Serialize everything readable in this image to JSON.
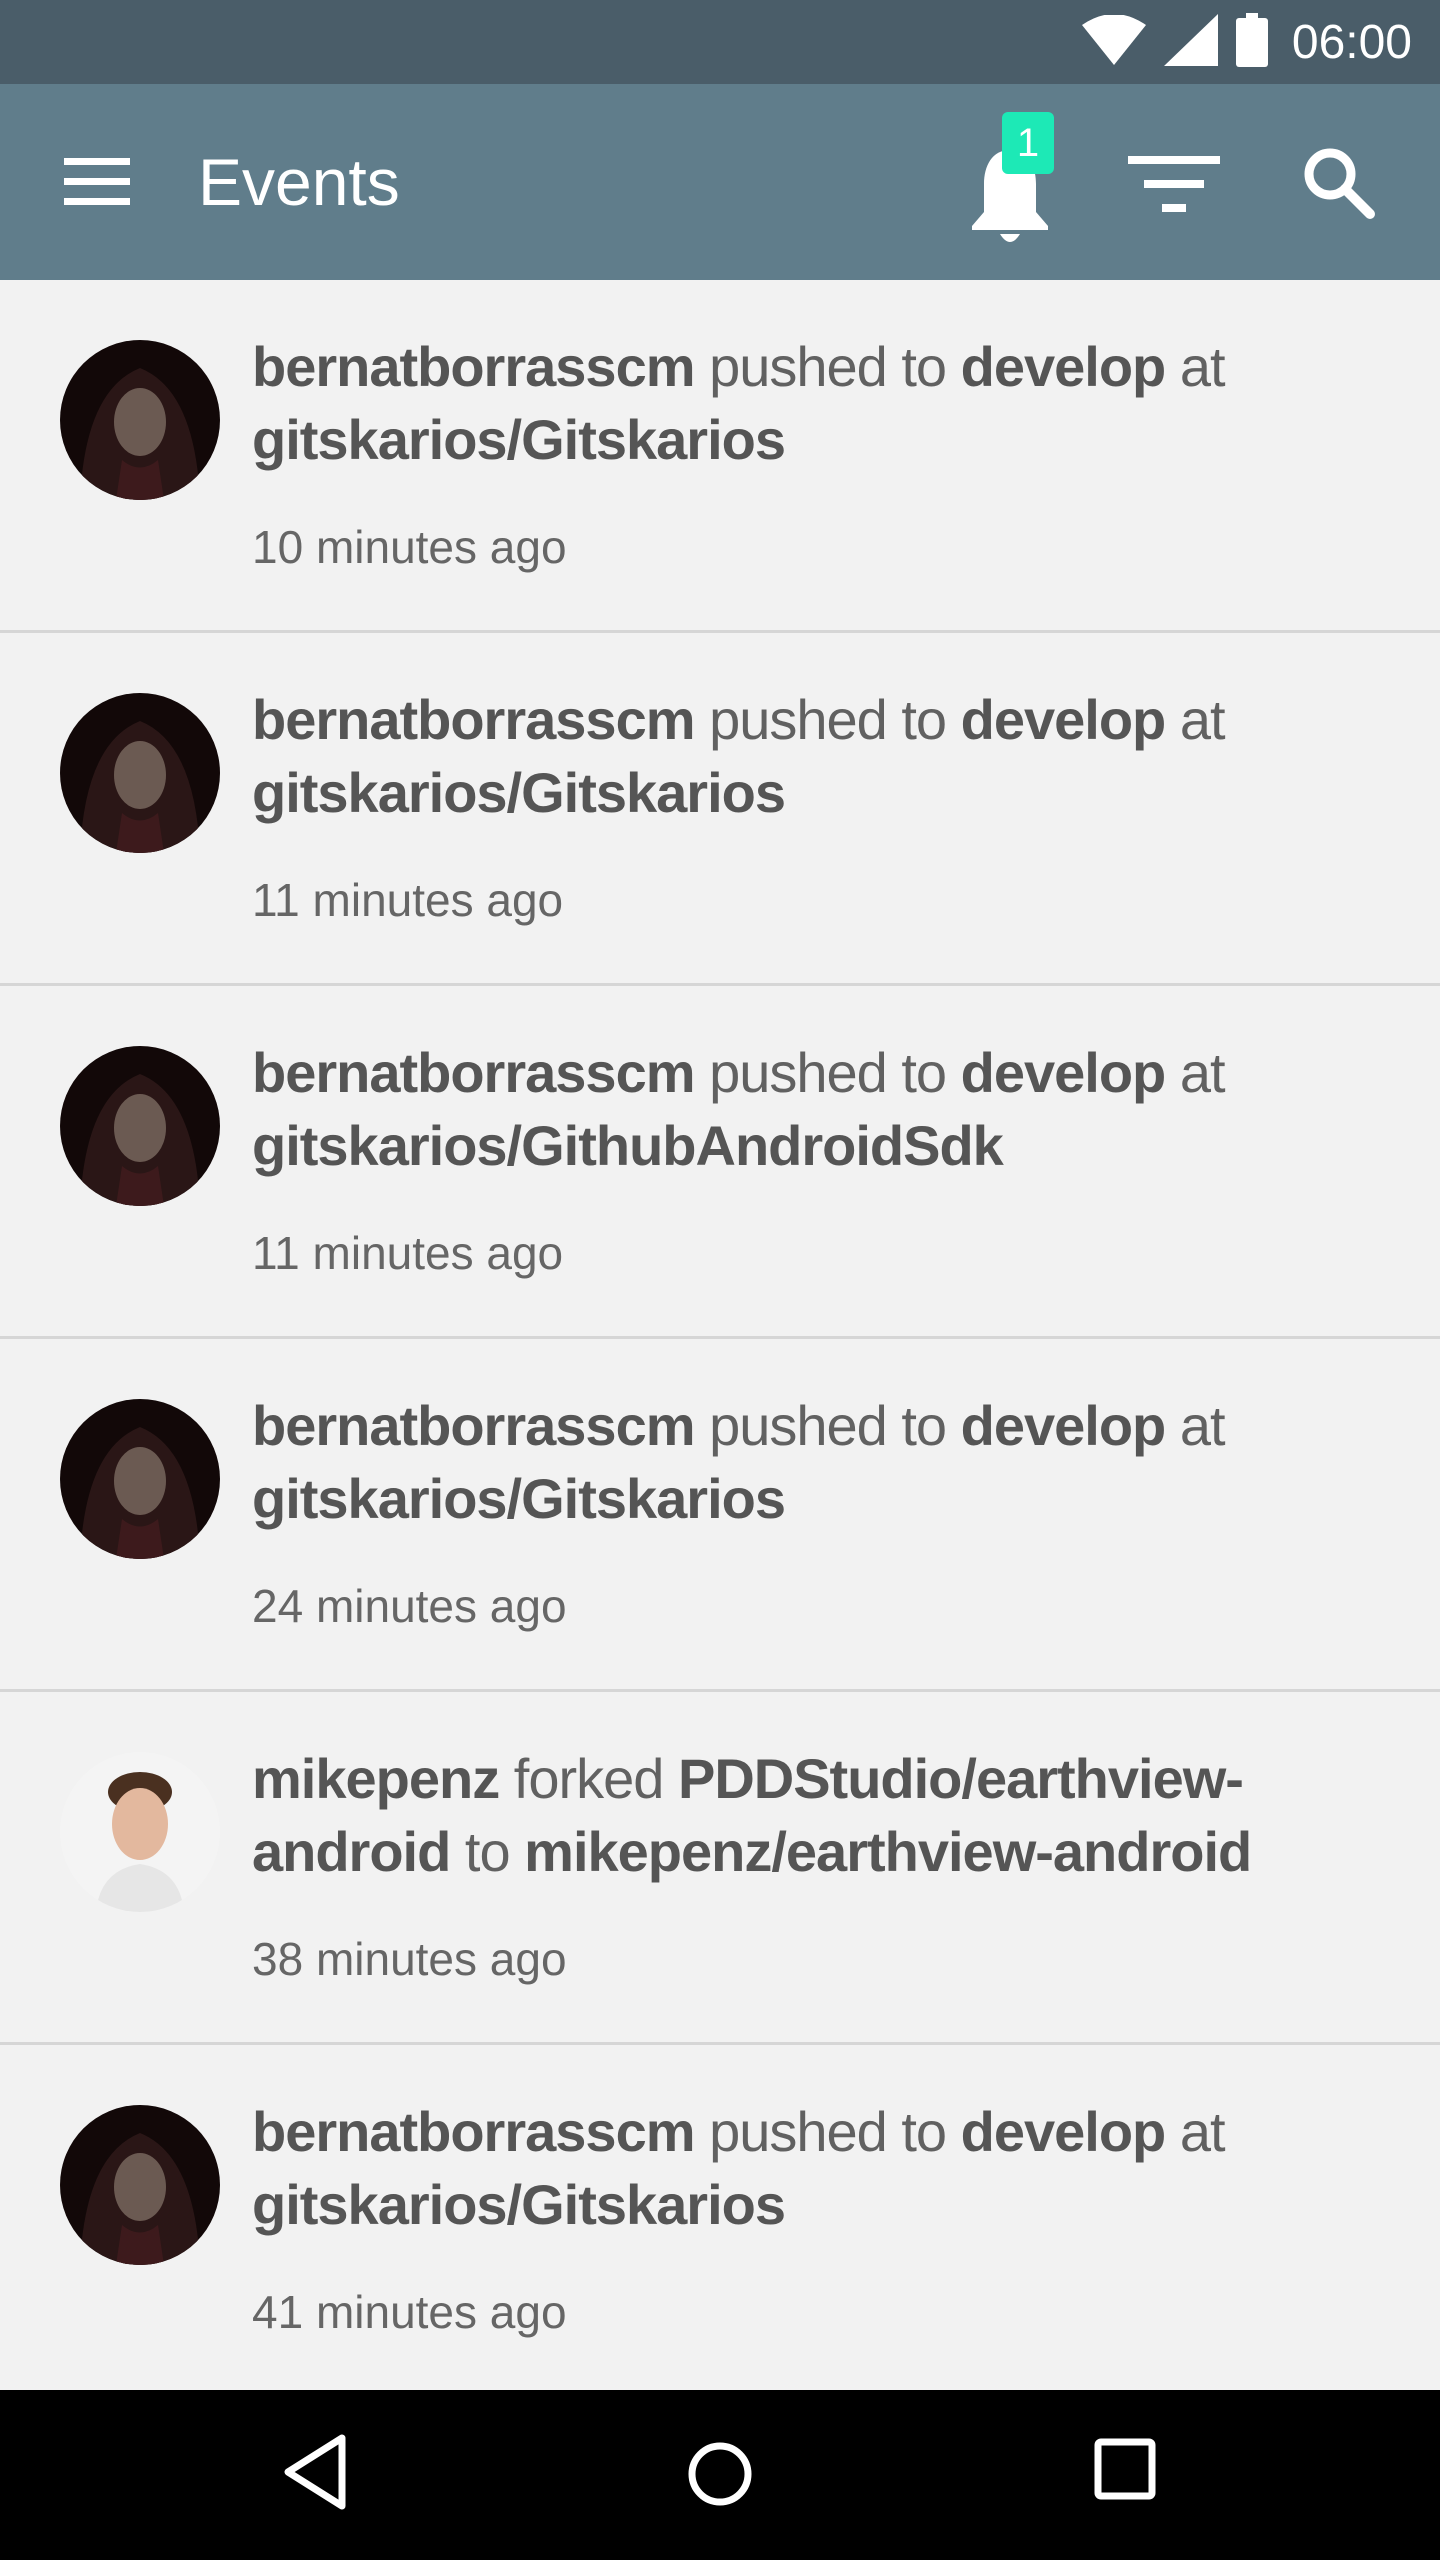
{
  "status_bar": {
    "time": "06:00",
    "icons": [
      "wifi-icon",
      "signal-icon",
      "battery-icon"
    ]
  },
  "app_bar": {
    "title": "Events",
    "notification_count": "1",
    "icons": [
      "menu-icon",
      "bell-icon",
      "filter-icon",
      "search-icon"
    ],
    "background": "#607d8b",
    "badge_color": "#1de9b6"
  },
  "events": [
    {
      "user": "bernatborrasscm",
      "action": "pushed to",
      "branch": "develop",
      "connector": "at",
      "repo": "gitskarios/Gitskarios",
      "time": "10 minutes ago",
      "avatar": "hooded-user-avatar"
    },
    {
      "user": "bernatborrasscm",
      "action": "pushed to",
      "branch": "develop",
      "connector": "at",
      "repo": "gitskarios/Gitskarios",
      "time": "11 minutes ago",
      "avatar": "hooded-user-avatar"
    },
    {
      "user": "bernatborrasscm",
      "action": "pushed to",
      "branch": "develop",
      "connector": "at",
      "repo": "gitskarios/GithubAndroidSdk",
      "time": "11 minutes ago",
      "avatar": "hooded-user-avatar"
    },
    {
      "user": "bernatborrasscm",
      "action": "pushed to",
      "branch": "develop",
      "connector": "at",
      "repo": "gitskarios/Gitskarios",
      "time": "24 minutes ago",
      "avatar": "hooded-user-avatar"
    },
    {
      "user": "mikepenz",
      "action": "forked",
      "source_repo": "PDDStudio/earthview-android",
      "connector": "to",
      "target_repo": "mikepenz/earthview-android",
      "time": "38 minutes ago",
      "avatar": "portrait-user-avatar"
    },
    {
      "user": "bernatborrasscm",
      "action": "pushed to",
      "branch": "develop",
      "connector": "at",
      "repo": "gitskarios/Gitskarios",
      "time": "41 minutes ago",
      "avatar": "hooded-user-avatar"
    }
  ],
  "nav_bar": {
    "icons": [
      "back-icon",
      "home-icon",
      "recent-apps-icon"
    ]
  }
}
